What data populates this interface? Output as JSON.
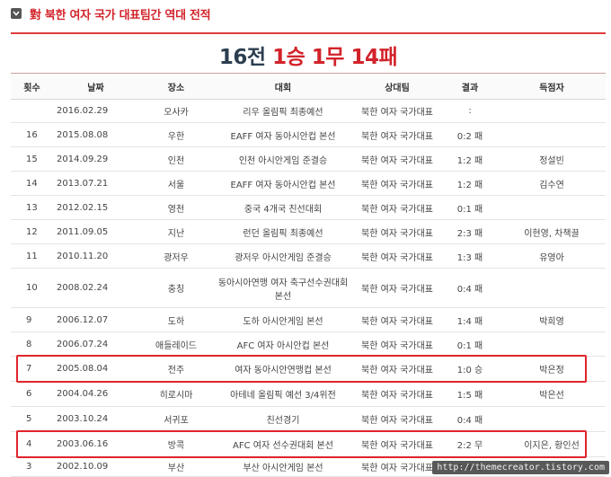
{
  "header": {
    "title": "對 북한 여자 국가 대표팀간 역대 전적"
  },
  "record": {
    "games": "16전",
    "wins": "1승",
    "draws": "1무",
    "losses": "14패"
  },
  "table": {
    "columns": [
      "횟수",
      "날짜",
      "장소",
      "대회",
      "상대팀",
      "결과",
      "득점자"
    ],
    "rows": [
      [
        "",
        "2016.02.29",
        "오사카",
        "리우 올림픽 최종예선",
        "북한 여자 국가대표",
        ":",
        ""
      ],
      [
        "16",
        "2015.08.08",
        "우한",
        "EAFF 여자 동아시안컵 본선",
        "북한 여자 국가대표",
        "0:2 패",
        ""
      ],
      [
        "15",
        "2014.09.29",
        "인천",
        "인천 아시안게임 준결승",
        "북한 여자 국가대표",
        "1:2 패",
        "정설빈"
      ],
      [
        "14",
        "2013.07.21",
        "서울",
        "EAFF 여자 동아시안컵 본선",
        "북한 여자 국가대표",
        "1:2 패",
        "김수연"
      ],
      [
        "13",
        "2012.02.15",
        "영천",
        "중국 4개국 친선대회",
        "북한 여자 국가대표",
        "0:1 패",
        ""
      ],
      [
        "12",
        "2011.09.05",
        "지난",
        "런던 올림픽 최종예선",
        "북한 여자 국가대표",
        "2:3 패",
        "이현영, 차책끌"
      ],
      [
        "11",
        "2010.11.20",
        "광저우",
        "광저우 아시안게임 준결승",
        "북한 여자 국가대표",
        "1:3 패",
        "유영아"
      ],
      [
        "10",
        "2008.02.24",
        "충칭",
        "동아시아연맹 여자 축구선수권대회 본선",
        "북한 여자 국가대표",
        "0:4 패",
        ""
      ],
      [
        "9",
        "2006.12.07",
        "도하",
        "도하 아시안게임 본선",
        "북한 여자 국가대표",
        "1:4 패",
        "박희영"
      ],
      [
        "8",
        "2006.07.24",
        "애들레이드",
        "AFC 여자 아시안컵 본선",
        "북한 여자 국가대표",
        "0:1 패",
        ""
      ],
      [
        "7",
        "2005.08.04",
        "전주",
        "여자 동아시안연맹컵 본선",
        "북한 여자 국가대표",
        "1:0 승",
        "박은정"
      ],
      [
        "6",
        "2004.04.26",
        "히로시마",
        "아테네 올림픽 예선 3/4위전",
        "북한 여자 국가대표",
        "1:5 패",
        "박은선"
      ],
      [
        "5",
        "2003.10.24",
        "서귀포",
        "친선경기",
        "북한 여자 국가대표",
        "0:4 패",
        ""
      ],
      [
        "4",
        "2003.06.16",
        "방콕",
        "AFC 여자 선수권대회 본선",
        "북한 여자 국가대표",
        "2:2 무",
        "이지은, 황인선"
      ],
      [
        "3",
        "2002.10.09",
        "부산",
        "부산 아시안게임 본선",
        "북한 여자 국가대표",
        "0:4 패",
        ""
      ]
    ]
  },
  "watermark": "http://themecreator.tistory.com",
  "colors": {
    "accent": "#d2232a",
    "record_dark": "#2c3e50",
    "highlight_border": "#e0242b"
  }
}
